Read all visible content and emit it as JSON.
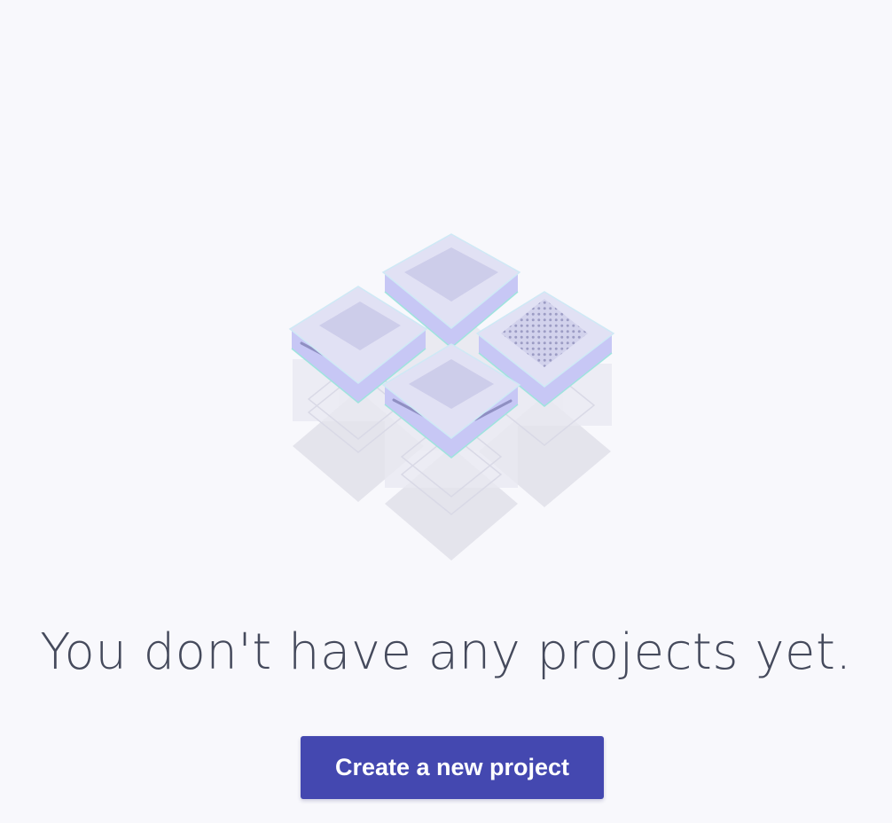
{
  "theme": {
    "background": "#f8f8fc",
    "heading_color": "#454a5c",
    "button_color": "#4448b0",
    "button_text_color": "#ffffff",
    "tile_top": "#e1e1f4",
    "tile_inset": "#cdcdea",
    "tile_side": "#c8c8f4",
    "reflection": "#e6e6ee"
  },
  "illustration": {
    "icon": "stacked-project-tiles-icon"
  },
  "empty_state": {
    "title": "You don't have any projects yet.",
    "cta_label": "Create a new project"
  }
}
